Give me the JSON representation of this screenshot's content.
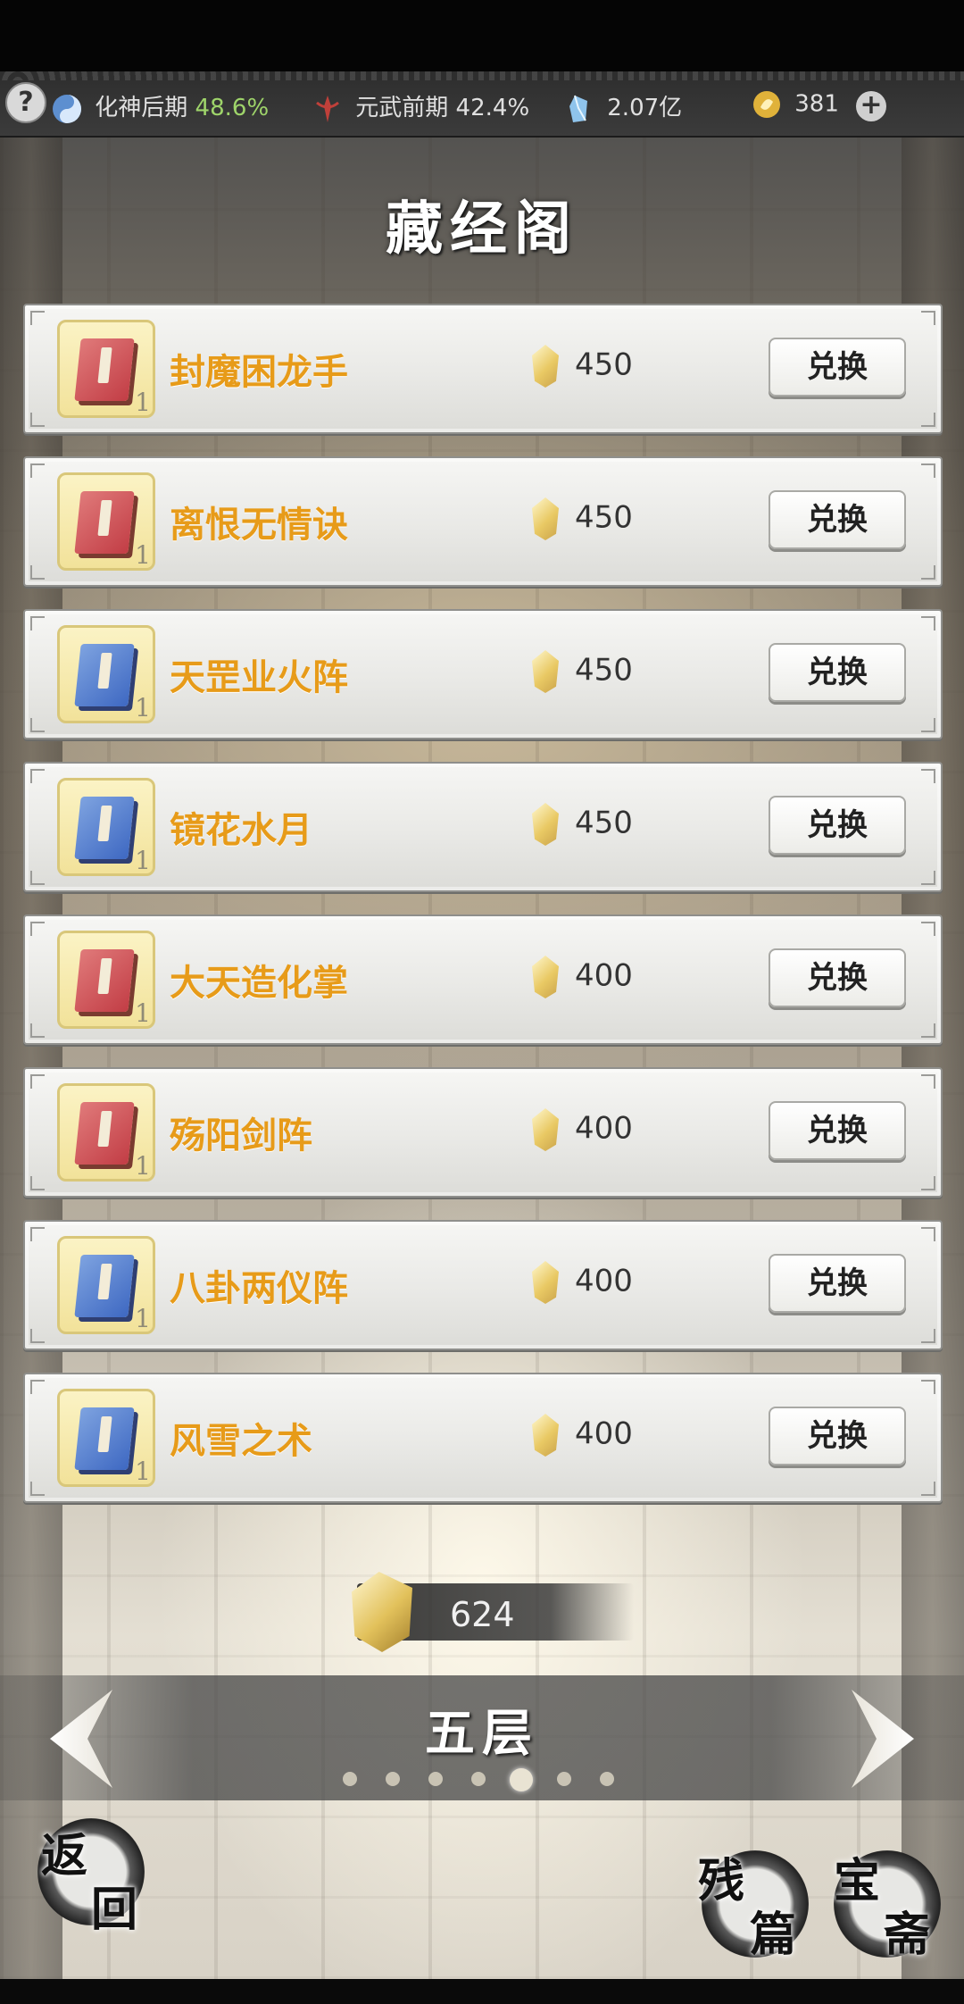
{
  "status": {
    "realm1_label": "化神后期",
    "realm1_pct": "48.6%",
    "realm2_label": "元武前期",
    "realm2_pct": "42.4%",
    "spirit_stones": "2.07亿",
    "gold": "381",
    "help_symbol": "?",
    "plus_symbol": "+"
  },
  "page": {
    "title": "藏经阁"
  },
  "items": [
    {
      "name": "封魔困龙手",
      "cost": "450",
      "count": "1",
      "book_color": "red",
      "button": "兑换"
    },
    {
      "name": "离恨无情诀",
      "cost": "450",
      "count": "1",
      "book_color": "red",
      "button": "兑换"
    },
    {
      "name": "天罡业火阵",
      "cost": "450",
      "count": "1",
      "book_color": "blue",
      "button": "兑换"
    },
    {
      "name": "镜花水月",
      "cost": "450",
      "count": "1",
      "book_color": "blue",
      "button": "兑换"
    },
    {
      "name": "大天造化掌",
      "cost": "400",
      "count": "1",
      "book_color": "red",
      "button": "兑换"
    },
    {
      "name": "殇阳剑阵",
      "cost": "400",
      "count": "1",
      "book_color": "red",
      "button": "兑换"
    },
    {
      "name": "八卦两仪阵",
      "cost": "400",
      "count": "1",
      "book_color": "blue",
      "button": "兑换"
    },
    {
      "name": "风雪之术",
      "cost": "400",
      "count": "1",
      "book_color": "blue",
      "button": "兑换"
    }
  ],
  "currency": {
    "amount": "624"
  },
  "floor": {
    "name": "五层",
    "page_count": 7,
    "current_page": 5
  },
  "nav": {
    "back_char1": "返",
    "back_char2": "回",
    "fragments_char1": "残",
    "fragments_char2": "篇",
    "treasure_char1": "宝",
    "treasure_char2": "斋"
  },
  "colors": {
    "item_name": "#e79b19",
    "realm_pct": "#9ed46a"
  },
  "icons": [
    "help-icon",
    "yin-yang-icon",
    "realm-emblem-icon",
    "spirit-stone-icon",
    "gold-coin-icon",
    "plus-icon",
    "book-icon",
    "crystal-icon",
    "arrow-left-icon",
    "arrow-right-icon"
  ]
}
